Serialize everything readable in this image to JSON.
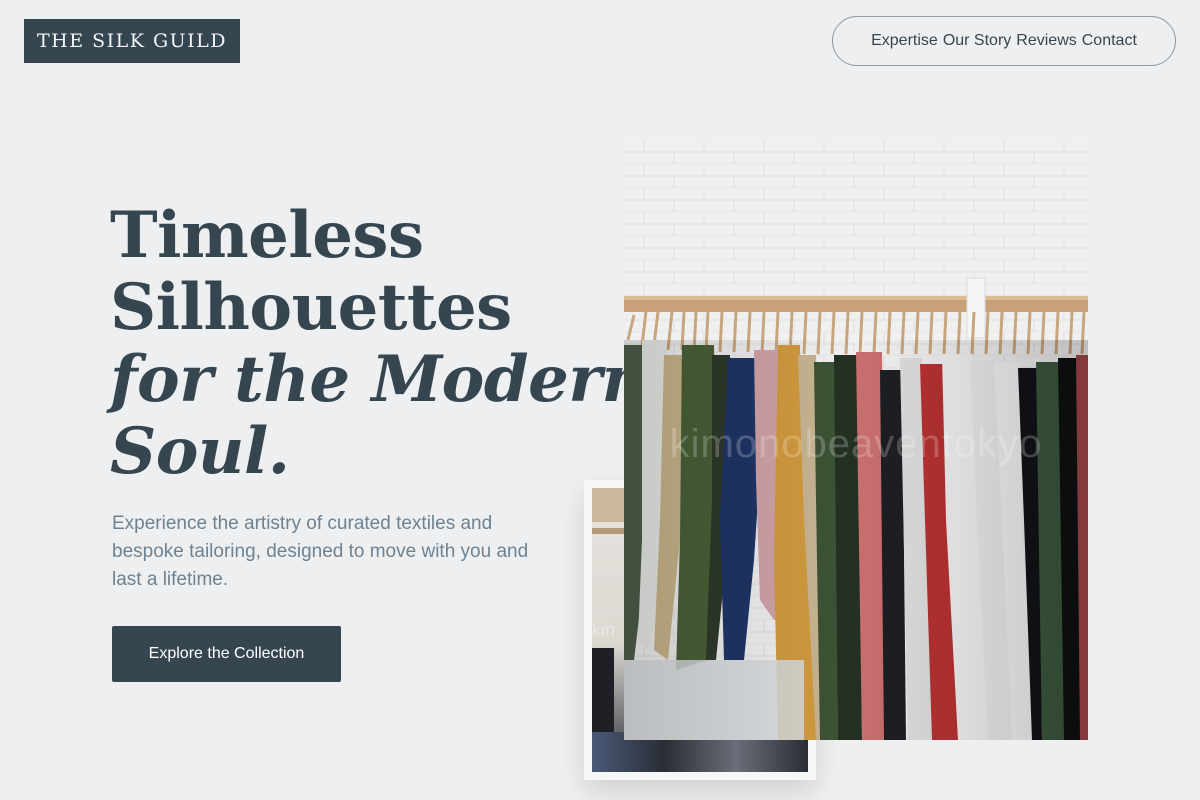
{
  "brand": {
    "logo": "THE SILK GUILD"
  },
  "nav": {
    "items": [
      "Expertise",
      "Our Story",
      "Reviews",
      "Contact"
    ]
  },
  "hero": {
    "title_lines": [
      "Timeless",
      "Silhouettes"
    ],
    "title_italic_lines": [
      "for the Modern",
      "Soul."
    ],
    "description": "Experience the artistry of curated textiles and bespoke tailoring, designed to move with you and last a lifetime.",
    "cta_label": "Explore the Collection"
  },
  "photos": {
    "main_watermark": "kimonobeaventokyo",
    "back_watermark": "kin"
  },
  "colors": {
    "background": "#edeff1",
    "primary": "#364650",
    "muted_text": "#6e8291",
    "nav_border": "#8d9aa2"
  }
}
